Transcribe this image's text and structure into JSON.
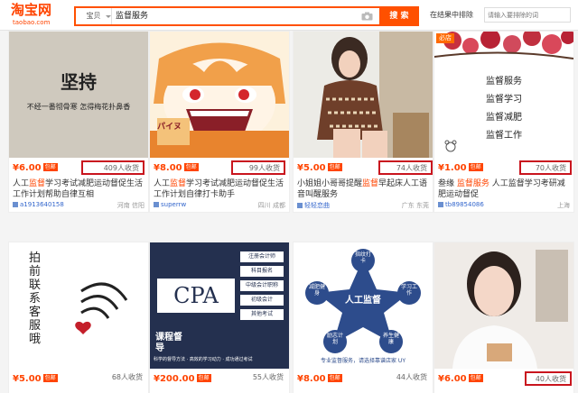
{
  "header": {
    "logo_text": "淘宝网",
    "logo_sub": "taobao.com",
    "scope": "宝贝",
    "search_query": "监督服务",
    "search_button": "搜 索",
    "refine_label": "在结果中排除",
    "refine_placeholder": "请输入要排除的词"
  },
  "products": [
    {
      "price": "¥6.00",
      "tag": "包邮",
      "count": "409人收货",
      "count_highlighted": true,
      "title_pre": "人工",
      "title_hl": "监督",
      "title_post": "学习考试减肥运动督促生活工作计划帮助自律互相",
      "shop": "a19136401​58",
      "location": "河南 信阳",
      "image_text_big": "坚持",
      "image_text_small": "不经一番彻骨寒 怎得梅花扑鼻香"
    },
    {
      "price": "¥8.00",
      "tag": "包邮",
      "count": "99人收货",
      "count_highlighted": true,
      "title_pre": "人工",
      "title_hl": "监督",
      "title_post": "学习考试减肥运动督促生活工作计划自律打卡助手",
      "shop": "superrw",
      "location": "四川 成都",
      "image_text_big": "パイヌ",
      "image_text_small": ""
    },
    {
      "price": "¥5.00",
      "tag": "包邮",
      "count": "74人收货",
      "count_highlighted": true,
      "title_pre": "小姐姐小哥哥提醒",
      "title_hl": "监督",
      "title_post": "早起床人工语音叫醒服务",
      "shop": "轻轻恋曲",
      "location": "广东 东莞",
      "image_text_big": "",
      "image_text_small": ""
    },
    {
      "price": "¥1.00",
      "tag": "包邮",
      "count": "70人收货",
      "count_highlighted": true,
      "title_pre": "叁缘 ",
      "title_hl": "监督服务",
      "title_post": " 人工监督学习考研减肥运动督促",
      "shop": "tb89854086",
      "location": "上海",
      "badge": "必店",
      "image_lines": [
        "监督服务",
        "监督学习",
        "监督减肥",
        "监督工作"
      ]
    },
    {
      "price": "¥5.00",
      "tag": "包邮",
      "count": "68人收货",
      "count_highlighted": false,
      "title_pre": "",
      "title_hl": "",
      "title_post": "",
      "shop": "",
      "location": "",
      "image_text_big": "拍前联系客服哦",
      "image_text_small": ""
    },
    {
      "price": "¥200.00",
      "tag": "包邮",
      "count": "55人收货",
      "count_highlighted": false,
      "title_pre": "",
      "title_hl": "",
      "title_post": "",
      "shop": "",
      "location": "",
      "image_text_big": "CPA",
      "image_text_small": "课程督导",
      "image_caption": "科学的督导方法 · 高效的学习动力 · 成功通过考试",
      "image_menu": [
        "注册会计师",
        "科目报名",
        "中级会计职称",
        "初级会计",
        "其他考试"
      ]
    },
    {
      "price": "¥8.00",
      "tag": "包邮",
      "count": "44人收货",
      "count_highlighted": false,
      "title_pre": "",
      "title_hl": "",
      "title_post": "",
      "shop": "",
      "location": "",
      "image_text_big": "人工监督",
      "image_nodes": [
        "指纹打卡",
        "学习工作",
        "养生健康",
        "励志计划",
        "减肥健身"
      ],
      "image_caption": "专业监督服务，请选择靠谱店家 UY"
    },
    {
      "price": "¥6.00",
      "tag": "包邮",
      "count": "40人收货",
      "count_highlighted": true,
      "title_pre": "",
      "title_hl": "",
      "title_post": "",
      "shop": "",
      "location": "",
      "image_text_big": "",
      "image_text_small": ""
    }
  ],
  "colors": {
    "brand": "#ff4400",
    "search_border": "#ff5000",
    "highlight_box": "#c9151e",
    "shop_link": "#3366cc"
  }
}
